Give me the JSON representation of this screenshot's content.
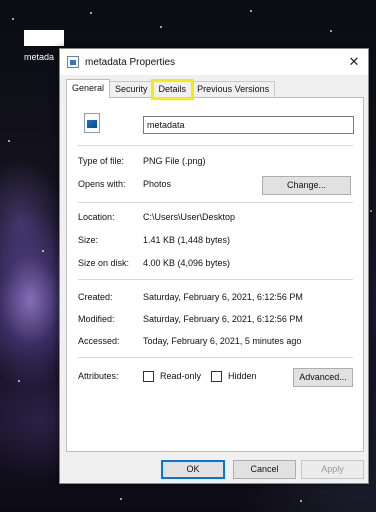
{
  "desktop": {
    "icon_label": "metada"
  },
  "dialog": {
    "title": "metadata Properties",
    "close_glyph": "✕",
    "tabs": [
      {
        "label": "General"
      },
      {
        "label": "Security"
      },
      {
        "label": "Details"
      },
      {
        "label": "Previous Versions"
      }
    ],
    "active_tab": "General",
    "highlighted_tab": "Details",
    "highlight_color": "#f5ee00",
    "general": {
      "file_name": "metadata",
      "type_label": "Type of file:",
      "type_value": "PNG File (.png)",
      "opens_label": "Opens with:",
      "opens_value": "Photos",
      "change_button": "Change...",
      "location_label": "Location:",
      "location_value": "C:\\Users\\User\\Desktop",
      "size_label": "Size:",
      "size_value": "1.41 KB (1,448 bytes)",
      "size_disk_label": "Size on disk:",
      "size_disk_value": "4.00 KB (4,096 bytes)",
      "created_label": "Created:",
      "created_value": "Saturday, February 6, 2021, 6:12:56 PM",
      "modified_label": "Modified:",
      "modified_value": "Saturday, February 6, 2021, 6:12:56 PM",
      "accessed_label": "Accessed:",
      "accessed_value": "Today, February 6, 2021, 5 minutes ago",
      "attributes_label": "Attributes:",
      "readonly_label": "Read-only",
      "hidden_label": "Hidden",
      "advanced_button": "Advanced..."
    },
    "footer": {
      "ok": "OK",
      "cancel": "Cancel",
      "apply": "Apply"
    }
  }
}
